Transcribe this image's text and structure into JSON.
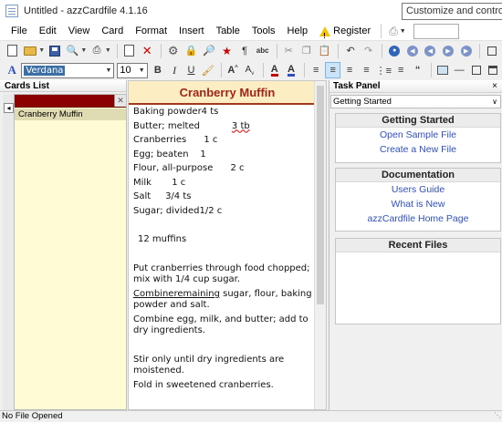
{
  "window": {
    "title": "Untitled - azzCardfile 4.1.16",
    "tooltip": "Customize and control Google Chrome"
  },
  "menu": {
    "items": [
      "File",
      "Edit",
      "View",
      "Card",
      "Format",
      "Insert",
      "Table",
      "Tools",
      "Help"
    ],
    "register_label": "Register"
  },
  "format_toolbar": {
    "font_name": "Verdana",
    "font_size": "10",
    "bold": "B",
    "italic": "I",
    "underline": "U"
  },
  "cards_list": {
    "header": "Cards List",
    "items": [
      "Cranberry Muffin"
    ]
  },
  "card": {
    "title": "Cranberry Muffin",
    "lines": [
      "Baking powder4 ts",
      "Butter; melted",
      "Cranberries      1 c",
      "Egg; beaten    1",
      "Flour, all-purpose      2 c",
      "Milk       1 c",
      "Salt     3/4 ts",
      "Sugar; divided1/2 c"
    ],
    "butter_amount": "3 tb",
    "yield": "12 muffins",
    "step1": "Put cranberries through food chopped; mix with 1/4 cup sugar.",
    "step2_word": "Combineremaining",
    "step2_rest": " sugar, flour, baking powder and salt.",
    "step3": "Combine egg, milk, and butter; add to dry ingredients.",
    "step4": "Stir only until dry ingredients are moistened.",
    "step5": "Fold in sweetened cranberries."
  },
  "task_panel": {
    "header": "Task Panel",
    "close": "×",
    "selector": "Getting Started",
    "getting_started": {
      "title": "Getting Started",
      "links": [
        "Open Sample File",
        "Create a New File"
      ]
    },
    "documentation": {
      "title": "Documentation",
      "links": [
        "Users Guide",
        "What is New",
        "azzCardfile Home Page"
      ]
    },
    "recent_files": {
      "title": "Recent Files"
    }
  },
  "status": {
    "text": "No File Opened"
  },
  "colors": {
    "title_red": "#a0251b",
    "link_blue": "#2f4fc2",
    "search_bar": "#8b0000",
    "list_bg": "#fffbd5"
  }
}
